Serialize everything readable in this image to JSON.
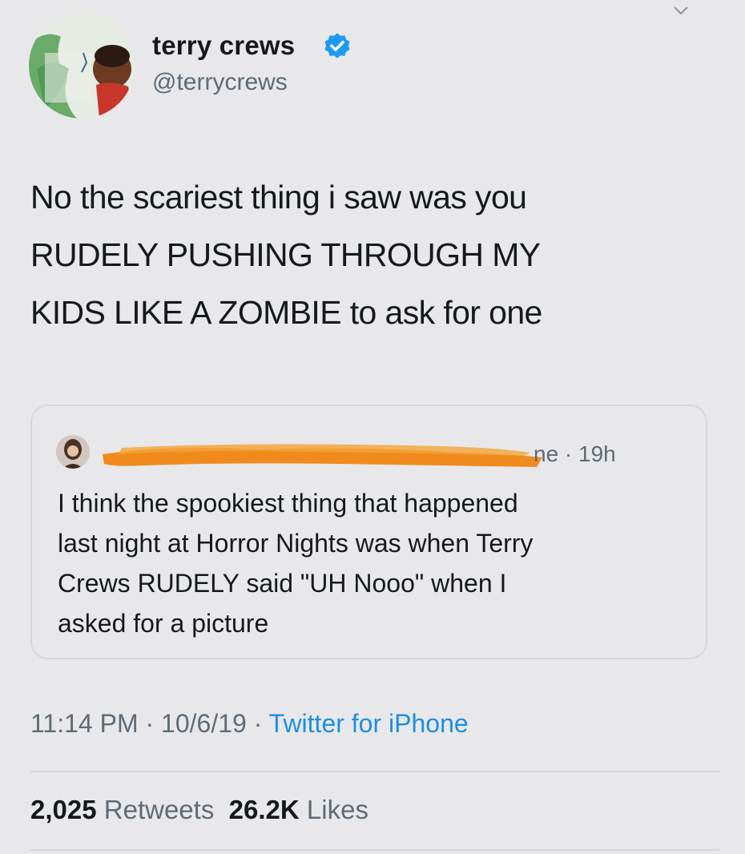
{
  "author": {
    "name": "terry crews",
    "handle": "@terrycrews",
    "verified": true
  },
  "tweet": {
    "text_lines": [
      "No the scariest thing i saw was you",
      "RUDELY PUSHING THROUGH MY",
      "KIDS LIKE A ZOMBIE to ask for one"
    ]
  },
  "quoted_tweet": {
    "meta": "ne · 19h",
    "text_lines": [
      "I think the spookiest thing that happened",
      "last night at Horror Nights was when Terry",
      "Crews RUDELY said \"UH Nooo\" when I",
      "asked for a picture"
    ]
  },
  "meta": {
    "time": "11:14 PM",
    "date": "10/6/19",
    "separator": " · ",
    "source": "Twitter for iPhone"
  },
  "stats": {
    "retweets_count": "2,025",
    "retweets_label": "Retweets",
    "likes_count": "26.2K",
    "likes_label": "Likes"
  },
  "colors": {
    "accent": "#1d8fe0",
    "redaction": "#f08a1c",
    "secondary_text": "#5f6a74"
  }
}
